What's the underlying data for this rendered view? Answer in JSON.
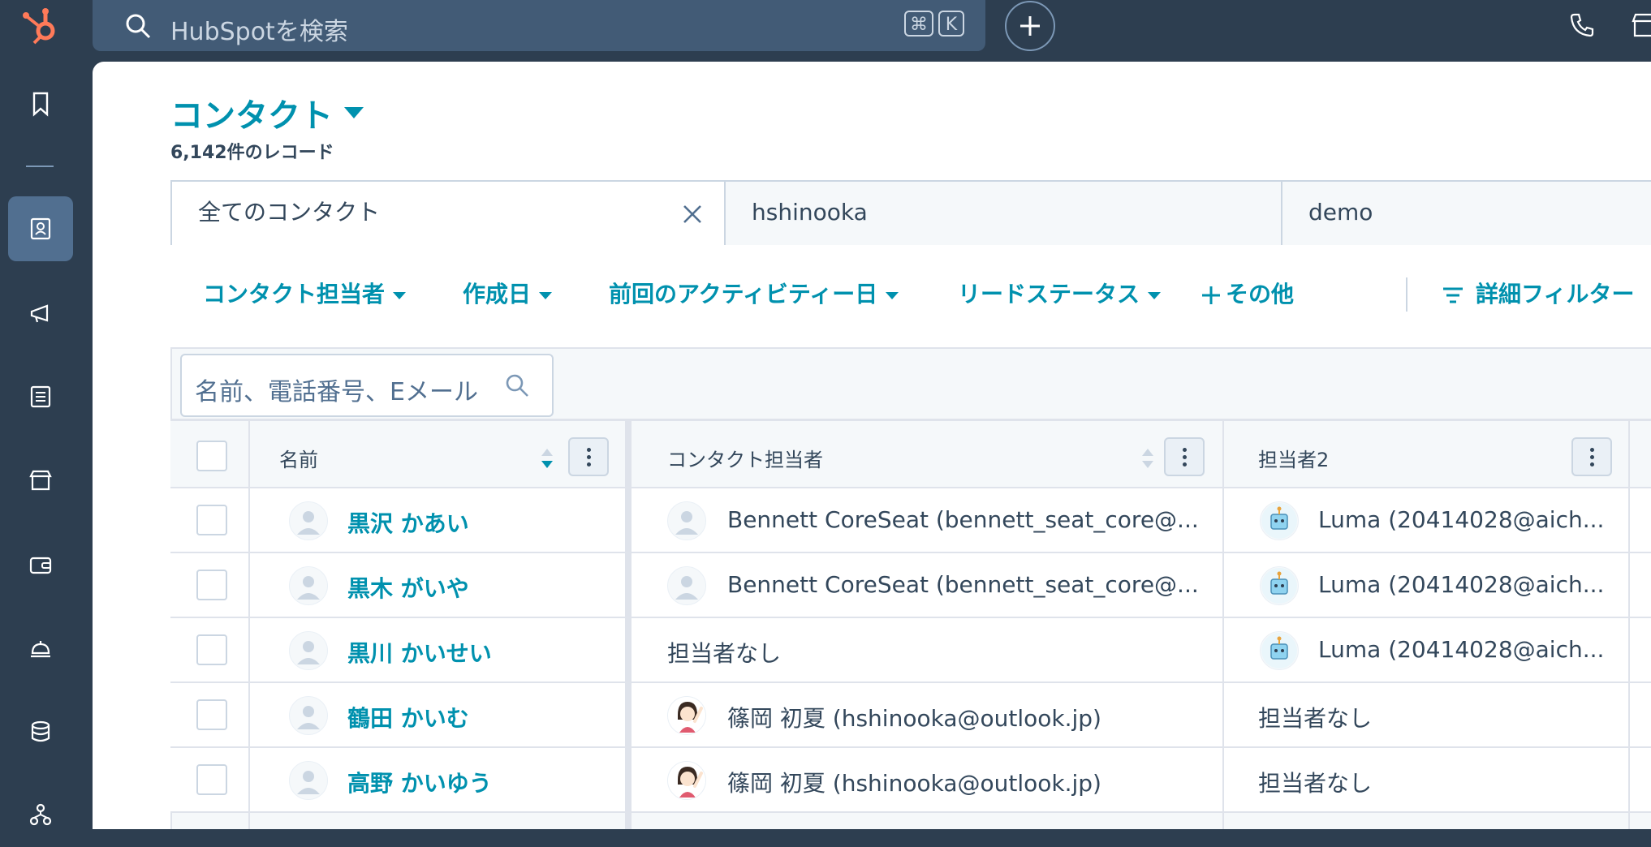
{
  "topbar": {
    "search_placeholder": "HubSpotを検索",
    "shortcut_keys": [
      "⌘",
      "K"
    ]
  },
  "page": {
    "title": "コンタクト",
    "record_count": "6,142件のレコード"
  },
  "view_tabs": [
    {
      "label": "全てのコンタクト",
      "active": true
    },
    {
      "label": "hshinooka",
      "active": false
    },
    {
      "label": "demo",
      "active": false
    }
  ],
  "filters": {
    "owner": "コンタクト担当者",
    "created": "作成日",
    "last_activity": "前回のアクティビティー日",
    "lead_status": "リードステータス",
    "more": "その他",
    "advanced": "詳細フィルター"
  },
  "table": {
    "search_placeholder": "名前、電話番号、Eメール",
    "columns": [
      "名前",
      "コンタクト担当者",
      "担当者2"
    ],
    "rows": [
      {
        "name": "黒沢 かあい",
        "owner": "Bennett CoreSeat (bennett_seat_core@...",
        "owner_avatar": "generic",
        "owner2": "Luma (20414028@aich...",
        "owner2_avatar": "luma"
      },
      {
        "name": "黒木 がいや",
        "owner": "Bennett CoreSeat (bennett_seat_core@...",
        "owner_avatar": "generic",
        "owner2": "Luma (20414028@aich...",
        "owner2_avatar": "luma"
      },
      {
        "name": "黒川 かいせい",
        "owner": "担当者なし",
        "owner_avatar": "none",
        "owner2": "Luma (20414028@aich...",
        "owner2_avatar": "luma"
      },
      {
        "name": "鶴田 かいむ",
        "owner": "篠岡 初夏 (hshinooka@outlook.jp)",
        "owner_avatar": "girl",
        "owner2": "担当者なし",
        "owner2_avatar": "none"
      },
      {
        "name": "高野 かいゆう",
        "owner": "篠岡 初夏 (hshinooka@outlook.jp)",
        "owner_avatar": "girl",
        "owner2": "担当者なし",
        "owner2_avatar": "none"
      }
    ]
  },
  "colors": {
    "nav_bg": "#2d3e50",
    "link": "#0091ae",
    "text": "#33475b",
    "logo": "#ff7a59"
  }
}
